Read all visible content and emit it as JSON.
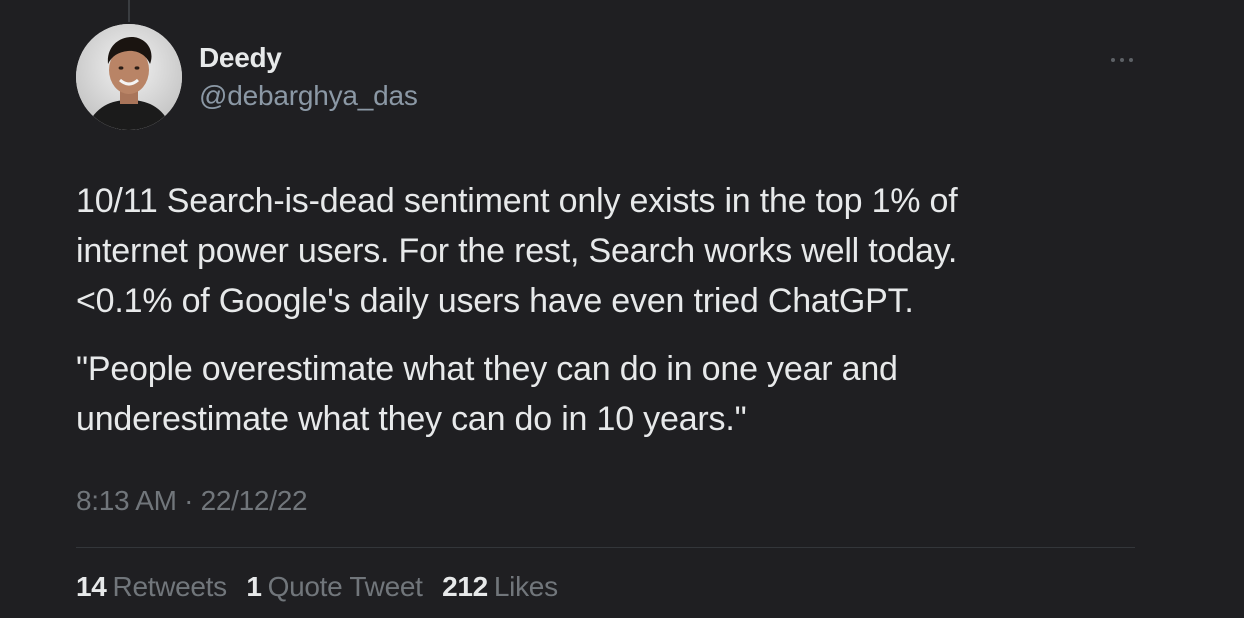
{
  "author": {
    "name": "Deedy",
    "handle": "@debarghya_das"
  },
  "tweet": {
    "lines_p1": [
      "10/11 Search-is-dead sentiment only exists in the top 1% of",
      "internet power users. For the rest, Search works well today.",
      "<0.1% of Google's daily users have even tried ChatGPT."
    ],
    "lines_p2": [
      "\"People overestimate what they can do in one year and",
      "underestimate what they can do in 10 years.\""
    ],
    "time": "8:13 AM",
    "separator": "·",
    "date": "22/12/22"
  },
  "stats": {
    "retweets_count": "14",
    "retweets_label": "Retweets",
    "quotes_count": "1",
    "quotes_label": "Quote Tweet",
    "likes_count": "212",
    "likes_label": "Likes"
  },
  "icons": {
    "more": "more-horizontal-icon"
  },
  "colors": {
    "background": "#1f1f22",
    "text": "#e7e9ea",
    "secondary": "#71767b"
  }
}
